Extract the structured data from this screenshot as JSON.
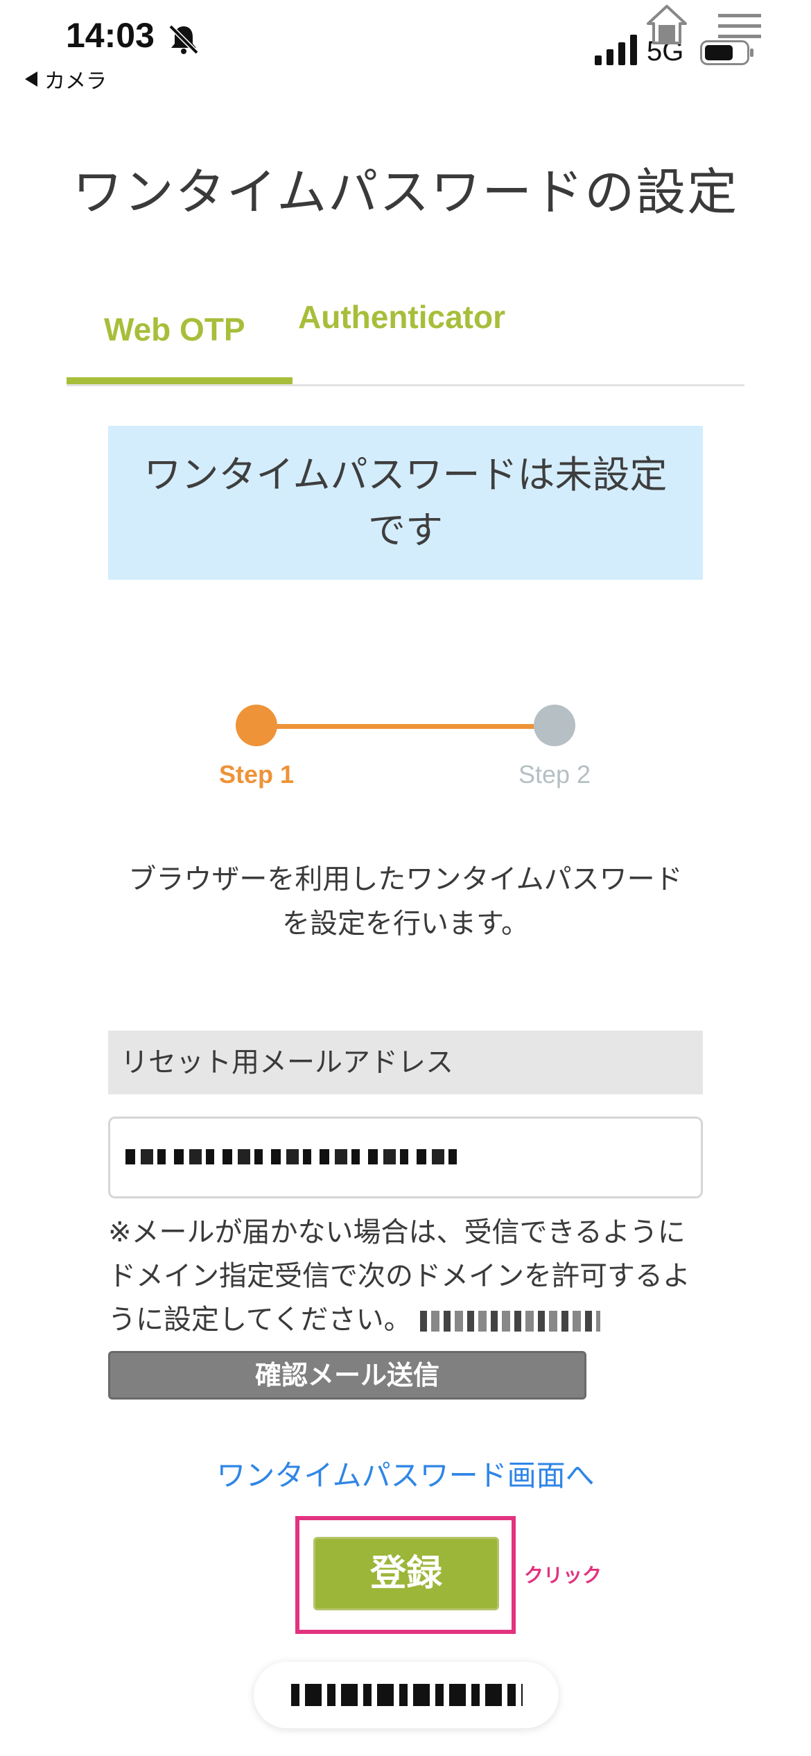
{
  "status_bar": {
    "time": "14:03",
    "back_label": "カメラ",
    "network": "5G"
  },
  "page": {
    "title": "ワンタイムパスワードの設定"
  },
  "tabs": [
    {
      "label": "Web OTP",
      "active": true
    },
    {
      "label": "Authenticator",
      "active": false
    }
  ],
  "notice": {
    "line1": "ワンタイムパスワードは未設定",
    "line2": "です"
  },
  "stepper": {
    "steps": [
      "Step 1",
      "Step 2"
    ],
    "current": 1
  },
  "description": {
    "line1": "ブラウザーを利用したワンタイムパスワード",
    "line2": "を設定を行います。"
  },
  "form": {
    "email_label": "リセット用メールアドレス",
    "note": "※メールが届かない場合は、受信できるようにドメイン指定受信で次のドメインを許可するように設定してください。",
    "send_button": "確認メール送信"
  },
  "link": {
    "text": "ワンタイムパスワード画面へ"
  },
  "register": {
    "label": "登録",
    "annotation": "クリック"
  },
  "colors": {
    "accent_green": "#a7be3a",
    "step_orange": "#ee9338",
    "link_blue": "#2f86e6",
    "highlight_pink": "#e2337f",
    "notice_bg": "#d4edfc"
  }
}
